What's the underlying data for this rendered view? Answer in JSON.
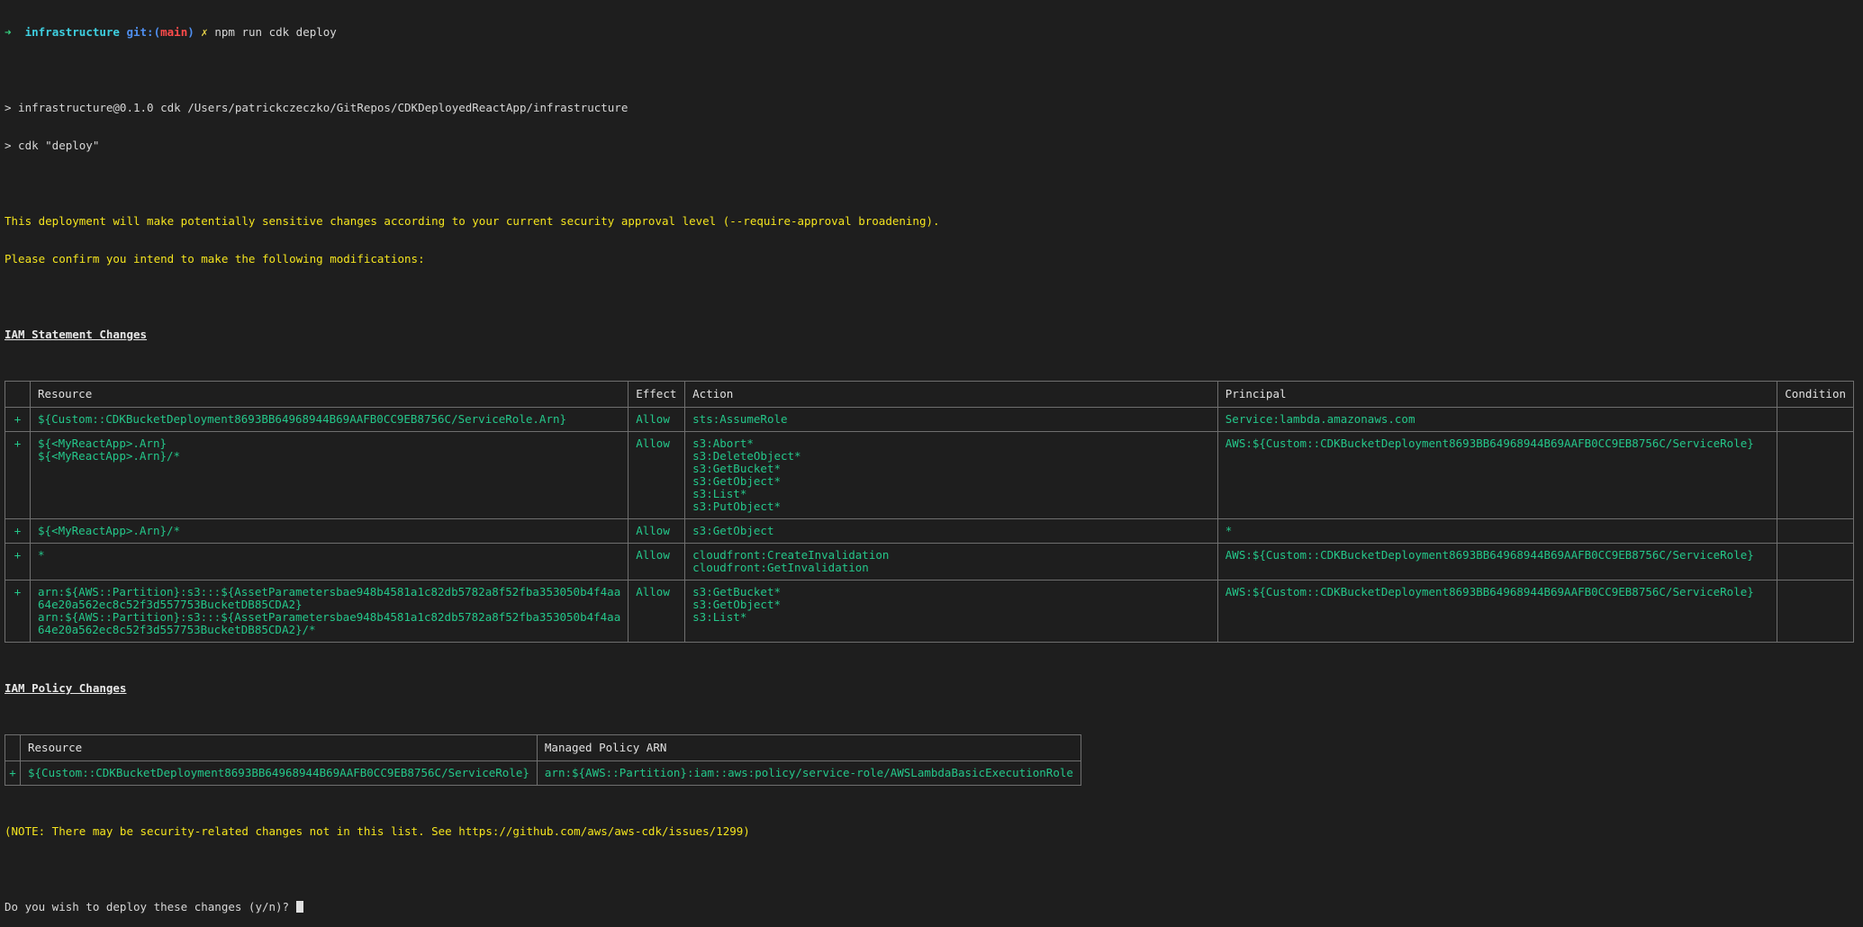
{
  "prompt": {
    "arrow": "➜",
    "dir": "infrastructure",
    "git_label": "git:(",
    "branch": "main",
    "git_close": ")",
    "dirty": "✗",
    "command": "npm run cdk deploy"
  },
  "output": {
    "npm_line1": "> infrastructure@0.1.0 cdk /Users/patrickczeczko/GitRepos/CDKDeployedReactApp/infrastructure",
    "npm_line2": "> cdk \"deploy\"",
    "warning1": "This deployment will make potentially sensitive changes according to your current security approval level (--require-approval broadening).",
    "warning2": "Please confirm you intend to make the following modifications:",
    "note": "(NOTE: There may be security-related changes not in this list. See https://github.com/aws/aws-cdk/issues/1299)",
    "confirm": "Do you wish to deploy these changes (y/n)? "
  },
  "iam_statements": {
    "title": "IAM Statement Changes",
    "headers": [
      "",
      "Resource",
      "Effect",
      "Action",
      "Principal",
      "Condition"
    ],
    "rows": [
      {
        "sign": "+",
        "resource": "${Custom::CDKBucketDeployment8693BB64968944B69AAFB0CC9EB8756C/ServiceRole.Arn}",
        "effect": "Allow",
        "action": "sts:AssumeRole",
        "principal": "Service:lambda.amazonaws.com",
        "condition": ""
      },
      {
        "sign": "+",
        "resource": "${<MyReactApp>.Arn}\n${<MyReactApp>.Arn}/*",
        "effect": "Allow",
        "action": "s3:Abort*\ns3:DeleteObject*\ns3:GetBucket*\ns3:GetObject*\ns3:List*\ns3:PutObject*",
        "principal": "AWS:${Custom::CDKBucketDeployment8693BB64968944B69AAFB0CC9EB8756C/ServiceRole}",
        "condition": ""
      },
      {
        "sign": "+",
        "resource": "${<MyReactApp>.Arn}/*",
        "effect": "Allow",
        "action": "s3:GetObject",
        "principal": "*",
        "condition": ""
      },
      {
        "sign": "+",
        "resource": "*",
        "effect": "Allow",
        "action": "cloudfront:CreateInvalidation\ncloudfront:GetInvalidation",
        "principal": "AWS:${Custom::CDKBucketDeployment8693BB64968944B69AAFB0CC9EB8756C/ServiceRole}",
        "condition": ""
      },
      {
        "sign": "+",
        "resource": "arn:${AWS::Partition}:s3:::${AssetParametersbae948b4581a1c82db5782a8f52fba353050b4f4aa\n64e20a562ec8c52f3d557753BucketDB85CDA2}\narn:${AWS::Partition}:s3:::${AssetParametersbae948b4581a1c82db5782a8f52fba353050b4f4aa\n64e20a562ec8c52f3d557753BucketDB85CDA2}/*",
        "effect": "Allow",
        "action": "s3:GetBucket*\ns3:GetObject*\ns3:List*",
        "principal": "AWS:${Custom::CDKBucketDeployment8693BB64968944B69AAFB0CC9EB8756C/ServiceRole}",
        "condition": ""
      }
    ]
  },
  "iam_policies": {
    "title": "IAM Policy Changes",
    "headers": [
      "",
      "Resource",
      "Managed Policy ARN"
    ],
    "rows": [
      {
        "sign": "+",
        "resource": "${Custom::CDKBucketDeployment8693BB64968944B69AAFB0CC9EB8756C/ServiceRole}",
        "arn": "arn:${AWS::Partition}:iam::aws:policy/service-role/AWSLambdaBasicExecutionRole"
      }
    ]
  }
}
